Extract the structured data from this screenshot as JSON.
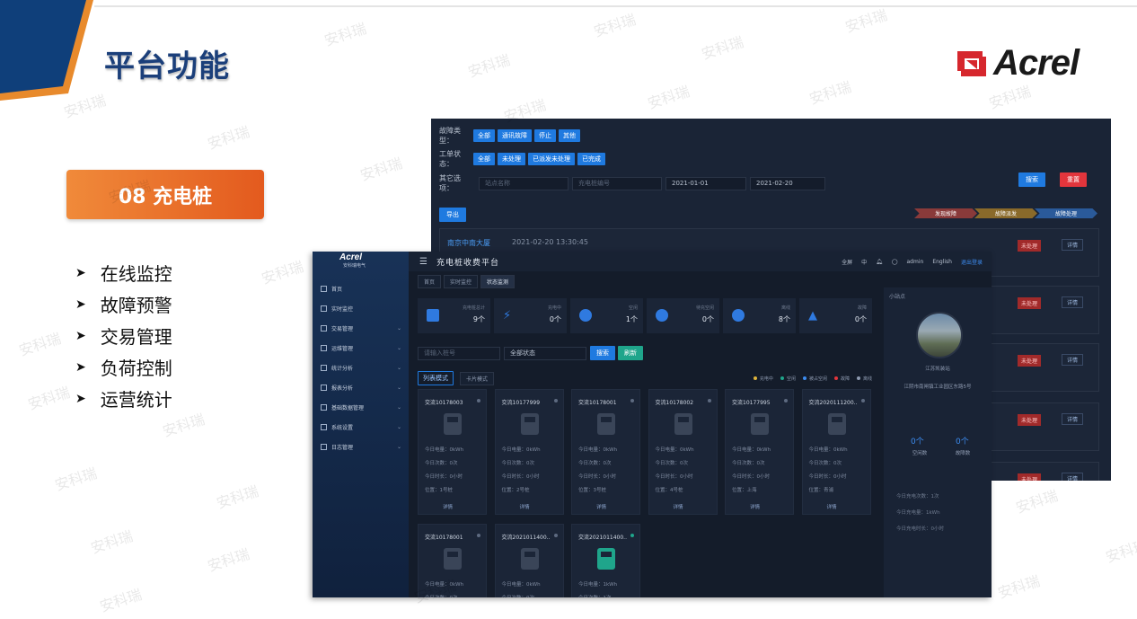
{
  "slide": {
    "title": "平台功能",
    "logo": "Acrel",
    "section": "08 充电桩",
    "features": [
      "在线监控",
      "故障预警",
      "交易管理",
      "负荷控制",
      "运营统计"
    ],
    "watermark": "安科瑞",
    "colors": {
      "title": "#1b3f7a",
      "badge": "#e35a1e",
      "corner_blue": "#0f3f7a",
      "corner_orange": "#e88a2c"
    }
  },
  "back_window": {
    "fault_label": "故障类型：",
    "fault_types": [
      "全部",
      "通讯故障",
      "停止",
      "其他"
    ],
    "order_label": "工单状态：",
    "order_states": [
      "全部",
      "未处理",
      "已派发未处理",
      "已完成"
    ],
    "other_label": "其它选项：",
    "station_placeholder": "站点名称",
    "pile_placeholder": "充电桩编号",
    "date_from": "2021-01-01",
    "date_to": "2021-02-20",
    "search": "搜索",
    "reset": "重置",
    "export": "导出",
    "steps": [
      "发现故障",
      "故障派发",
      "故障处理"
    ],
    "record_name": "南京中南大厦",
    "record_time": "2021-02-20 13:30:45",
    "status": "未处理",
    "detail": "详情"
  },
  "front_window": {
    "logo": "Acrel",
    "logo_sub": "安科瑞电气",
    "title": "充电桩收费平台",
    "menu": [
      "首页",
      "实时监控",
      "交易管理",
      "运维管理",
      "统计分析",
      "报表分析",
      "基础数据管理",
      "系统设置",
      "日志管理"
    ],
    "topbar": {
      "fullscreen": "全屏",
      "lang": "中",
      "user": "admin",
      "english": "English",
      "logout": "退出登录"
    },
    "tabs": [
      "首页",
      "实时监控",
      "状态监测"
    ],
    "stats": [
      {
        "name": "充电桩总计",
        "value": "9个"
      },
      {
        "name": "充电中",
        "value": "0个"
      },
      {
        "name": "空闲",
        "value": "1个"
      },
      {
        "name": "待充空闲",
        "value": "0个"
      },
      {
        "name": "离线",
        "value": "8个"
      },
      {
        "name": "故障",
        "value": "0个"
      }
    ],
    "search_placeholder": "请输入桩号",
    "status_select": "全部状态",
    "search_btn": "搜索",
    "refresh_btn": "刷新",
    "view_modes": [
      "列表模式",
      "卡片模式"
    ],
    "legend": [
      {
        "label": "充电中",
        "color": "#e0b53c"
      },
      {
        "label": "空闲",
        "color": "#1fa58b"
      },
      {
        "label": "被占空闲",
        "color": "#3c8cf0"
      },
      {
        "label": "故障",
        "color": "#e2353c"
      },
      {
        "label": "离线",
        "color": "#8e9ab0"
      }
    ],
    "cards": [
      {
        "name": "交流10178003",
        "power": "今日电量：0kWh",
        "count": "今日次数：0次",
        "time": "今日时长：0小时",
        "pos": "位置：1号桩",
        "green": false
      },
      {
        "name": "交流10177999",
        "power": "今日电量：0kWh",
        "count": "今日次数：0次",
        "time": "今日时长：0小时",
        "pos": "位置：2号桩",
        "green": false
      },
      {
        "name": "交流10178001",
        "power": "今日电量：0kWh",
        "count": "今日次数：0次",
        "time": "今日时长：0小时",
        "pos": "位置：3号桩",
        "green": false
      },
      {
        "name": "交流10178002",
        "power": "今日电量：0kWh",
        "count": "今日次数：0次",
        "time": "今日时长：0小时",
        "pos": "位置：4号桩",
        "green": false
      },
      {
        "name": "交流10177995",
        "power": "今日电量：0kWh",
        "count": "今日次数：0次",
        "time": "今日时长：0小时",
        "pos": "位置：上海",
        "green": false
      },
      {
        "name": "交流2020111200..",
        "power": "今日电量：0kWh",
        "count": "今日次数：0次",
        "time": "今日时长：0小时",
        "pos": "位置：青浦",
        "green": false
      },
      {
        "name": "交流10178001",
        "power": "今日电量：0kWh",
        "count": "今日次数：0次",
        "time": "",
        "pos": "",
        "green": false
      },
      {
        "name": "交流2021011400..",
        "power": "今日电量：0kWh",
        "count": "今日次数：0次",
        "time": "",
        "pos": "",
        "green": false
      },
      {
        "name": "交流2021011400..",
        "power": "今日电量：1kWh",
        "count": "今日次数：1次",
        "time": "",
        "pos": "",
        "green": true
      }
    ],
    "card_detail": "详情",
    "panel": {
      "title": "小站点",
      "station": "江苏凯装站",
      "address": "江阴市南闸镇工业园区东路5号",
      "left_num": "0个",
      "left_lbl": "空闲数",
      "right_num": "0个",
      "right_lbl": "故障数",
      "lines": [
        "今日充电次数：1次",
        "今日充电量：1kWh",
        "今日充电时长：0小时"
      ]
    }
  }
}
